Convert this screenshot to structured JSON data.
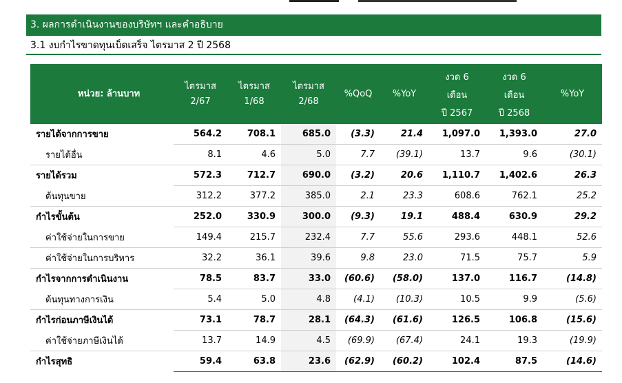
{
  "section": {
    "title": "3. ผลการดำเนินงานของบริษัทฯ และคำอธิบาย",
    "subtitle": "3.1 งบกำไรขาดทุนเบ็ดเสร็จ ไตรมาส 2 ปี 2568"
  },
  "table": {
    "header": {
      "unit": "หน่วย: ล้านบาท",
      "cols": [
        [
          "ไตรมาส",
          "2/67"
        ],
        [
          "ไตรมาส",
          "1/68"
        ],
        [
          "ไตรมาส",
          "2/68"
        ],
        [
          "%QoQ"
        ],
        [
          "%YoY"
        ],
        [
          "งวด 6",
          "เดือน",
          "ปี 2567"
        ],
        [
          "งวด 6",
          "เดือน",
          "ปี 2568"
        ],
        [
          "%YoY"
        ]
      ]
    },
    "rows": [
      {
        "label": "รายได้จากการขาย",
        "v": [
          "564.2",
          "708.1",
          "685.0",
          "(3.3)",
          "21.4",
          "1,097.0",
          "1,393.0",
          "27.0"
        ]
      },
      {
        "label": "รายได้อื่น",
        "v": [
          "8.1",
          "4.6",
          "5.0",
          "7.7",
          "(39.1)",
          "13.7",
          "9.6",
          "(30.1)"
        ]
      },
      {
        "label": "รายได้รวม",
        "v": [
          "572.3",
          "712.7",
          "690.0",
          "(3.2)",
          "20.6",
          "1,110.7",
          "1,402.6",
          "26.3"
        ]
      },
      {
        "label": "ต้นทุนขาย",
        "v": [
          "312.2",
          "377.2",
          "385.0",
          "2.1",
          "23.3",
          "608.6",
          "762.1",
          "25.2"
        ]
      },
      {
        "label": "กำไรขั้นต้น",
        "v": [
          "252.0",
          "330.9",
          "300.0",
          "(9.3)",
          "19.1",
          "488.4",
          "630.9",
          "29.2"
        ]
      },
      {
        "label": "ค่าใช้จ่ายในการขาย",
        "v": [
          "149.4",
          "215.7",
          "232.4",
          "7.7",
          "55.6",
          "293.6",
          "448.1",
          "52.6"
        ]
      },
      {
        "label": "ค่าใช้จ่ายในการบริหาร",
        "v": [
          "32.2",
          "36.1",
          "39.6",
          "9.8",
          "23.0",
          "71.5",
          "75.7",
          "5.9"
        ]
      },
      {
        "label": "กำไรจากการดำเนินงาน",
        "v": [
          "78.5",
          "83.7",
          "33.0",
          "(60.6)",
          "(58.0)",
          "137.0",
          "116.7",
          "(14.8)"
        ]
      },
      {
        "label": "ต้นทุนทางการเงิน",
        "v": [
          "5.4",
          "5.0",
          "4.8",
          "(4.1)",
          "(10.3)",
          "10.5",
          "9.9",
          "(5.6)"
        ]
      },
      {
        "label": "กำไรก่อนภาษีเงินได้",
        "v": [
          "73.1",
          "78.7",
          "28.1",
          "(64.3)",
          "(61.6)",
          "126.5",
          "106.8",
          "(15.6)"
        ]
      },
      {
        "label": "ค่าใช้จ่ายภาษีเงินได้",
        "v": [
          "13.7",
          "14.9",
          "4.5",
          "(69.9)",
          "(67.4)",
          "24.1",
          "19.3",
          "(19.9)"
        ]
      },
      {
        "label": "กำไรสุทธิ",
        "v": [
          "59.4",
          "63.8",
          "23.6",
          "(62.9)",
          "(60.2)",
          "102.4",
          "87.5",
          "(14.6)"
        ]
      }
    ]
  },
  "colors": {
    "header_green": "#1b7a3c",
    "shade": "#f2f2f2"
  }
}
